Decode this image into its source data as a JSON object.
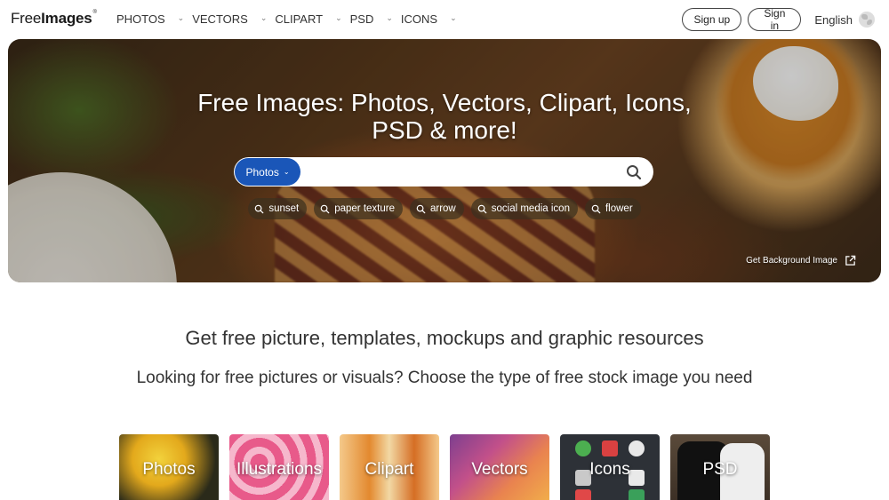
{
  "logo": {
    "text_free": "Free",
    "text_images": "Images",
    "mark": "®"
  },
  "nav": {
    "items": [
      {
        "label": "PHOTOS"
      },
      {
        "label": "VECTORS"
      },
      {
        "label": "CLIPART"
      },
      {
        "label": "PSD"
      },
      {
        "label": "ICONS"
      }
    ]
  },
  "auth": {
    "signup_label": "Sign up",
    "signin_label": "Sign in",
    "language_label": "English"
  },
  "hero": {
    "title_line1": "Free Images: Photos, Vectors, Clipart, Icons,",
    "title_line2": "PSD & more!",
    "search": {
      "type_label": "Photos",
      "value": "",
      "placeholder": ""
    },
    "tags": [
      {
        "label": "sunset"
      },
      {
        "label": "paper texture"
      },
      {
        "label": "arrow"
      },
      {
        "label": "social media icon"
      },
      {
        "label": "flower"
      }
    ],
    "background_link_label": "Get Background Image"
  },
  "main": {
    "headline": "Get free picture, templates, mockups and graphic resources",
    "subline": "Looking for free pictures or visuals? Choose the type of free stock image you need",
    "cards": [
      {
        "label": "Photos"
      },
      {
        "label": "Illustrations"
      },
      {
        "label": "Clipart"
      },
      {
        "label": "Vectors"
      },
      {
        "label": "Icons"
      },
      {
        "label": "PSD"
      }
    ]
  },
  "colors": {
    "accent": "#1a56b8",
    "text": "#333333",
    "tag_bg": "#3c301e"
  }
}
